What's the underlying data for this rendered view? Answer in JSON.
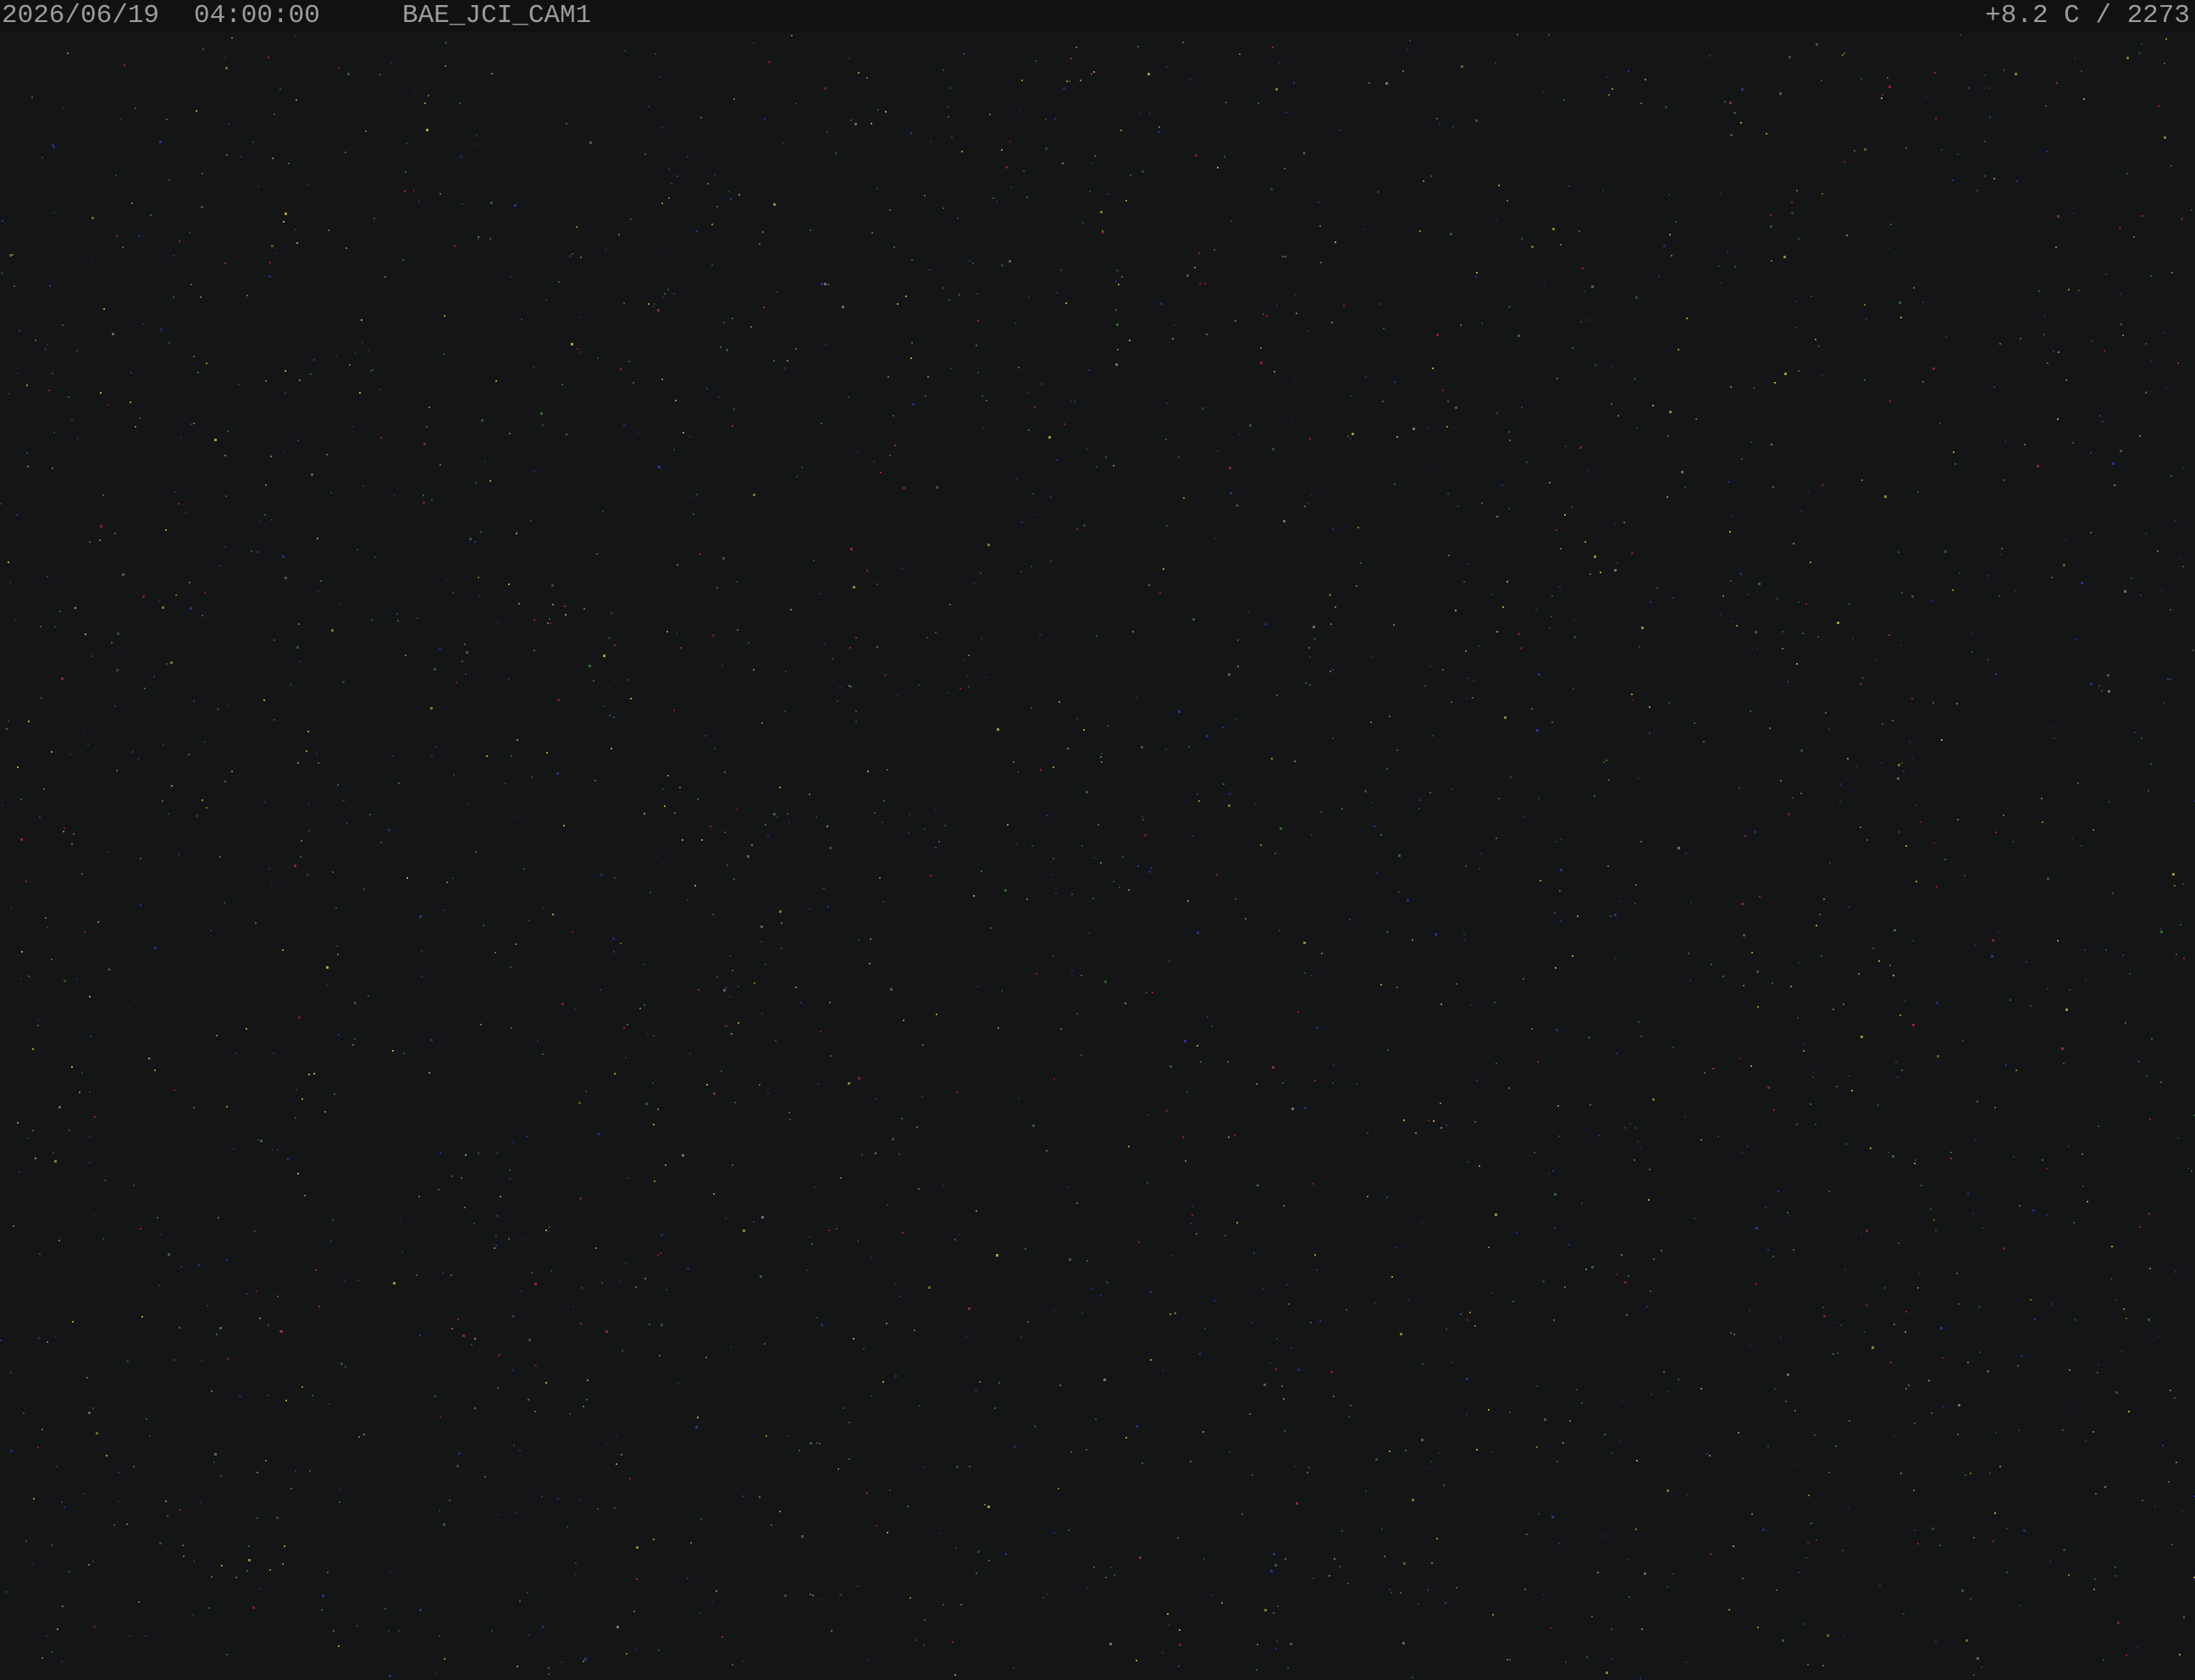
{
  "overlay": {
    "date": "2026/06/19",
    "time": "04:00:00",
    "camera_id": "BAE_JCI_CAM1",
    "temperature_reading": "+8.2 C / 2273"
  },
  "scene": {
    "description_color": "#141516",
    "noise_colors": [
      "#b02a3a",
      "#3a7a3a",
      "#3a3ab0",
      "#8a8a8a",
      "#d0c040"
    ]
  }
}
